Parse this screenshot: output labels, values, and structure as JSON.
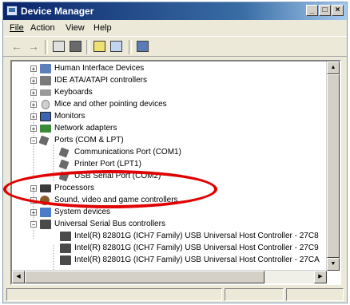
{
  "window": {
    "title": "Device Manager",
    "minimize": "_",
    "maximize": "□",
    "close": "×"
  },
  "menu": {
    "items": [
      {
        "label": "File",
        "underline": "F"
      },
      {
        "label": "Action",
        "underline": "A"
      },
      {
        "label": "View",
        "underline": "V"
      },
      {
        "label": "Help",
        "underline": "H"
      }
    ]
  },
  "toolbar": {
    "back": "←",
    "forward": "→"
  },
  "tree": {
    "items": [
      {
        "label": "Human Interface Devices",
        "expander": "+",
        "icon": "hid-icon",
        "color": "#5b7fb8"
      },
      {
        "label": "IDE ATA/ATAPI controllers",
        "expander": "+",
        "icon": "ide-icon",
        "color": "#7a7a7a"
      },
      {
        "label": "Keyboards",
        "expander": "+",
        "icon": "keyboard-icon",
        "color": "#9a9a9a"
      },
      {
        "label": "Mice and other pointing devices",
        "expander": "+",
        "icon": "mouse-icon",
        "color": "#c8c8c8"
      },
      {
        "label": "Monitors",
        "expander": "+",
        "icon": "monitor-icon",
        "color": "#3c64b4"
      },
      {
        "label": "Network adapters",
        "expander": "+",
        "icon": "network-icon",
        "color": "#3a8a3a"
      },
      {
        "label": "Ports (COM & LPT)",
        "expander": "−",
        "icon": "port-icon",
        "color": "#6a6a6a"
      },
      {
        "label": "Communications Port (COM1)",
        "expander": "",
        "icon": "port-child-icon",
        "color": "#6a6a6a"
      },
      {
        "label": "Printer Port (LPT1)",
        "expander": "",
        "icon": "port-child-icon",
        "color": "#6a6a6a"
      },
      {
        "label": "USB Serial Port (COM2)",
        "expander": "",
        "icon": "port-child-icon",
        "color": "#6a6a6a"
      },
      {
        "label": "Processors",
        "expander": "+",
        "icon": "processor-icon",
        "color": "#3a3a3a"
      },
      {
        "label": "Sound, video and game controllers",
        "expander": "+",
        "icon": "sound-icon",
        "color": "#8a5a2a"
      },
      {
        "label": "System devices",
        "expander": "+",
        "icon": "system-icon",
        "color": "#4a7ac8"
      },
      {
        "label": "Universal Serial Bus controllers",
        "expander": "−",
        "icon": "usb-icon",
        "color": "#4a4a4a"
      },
      {
        "label": "Intel(R) 82801G (ICH7 Family) USB Universal Host Controller - 27C8",
        "expander": "",
        "icon": "usb-child-icon",
        "color": "#4a4a4a"
      },
      {
        "label": "Intel(R) 82801G (ICH7 Family) USB Universal Host Controller - 27C9",
        "expander": "",
        "icon": "usb-child-icon",
        "color": "#4a4a4a"
      },
      {
        "label": "Intel(R) 82801G (ICH7 Family) USB Universal Host Controller - 27CA",
        "expander": "",
        "icon": "usb-child-icon",
        "color": "#4a4a4a"
      }
    ]
  },
  "scroll": {
    "up": "▲",
    "down": "▼",
    "left": "◀",
    "right": "▶"
  }
}
